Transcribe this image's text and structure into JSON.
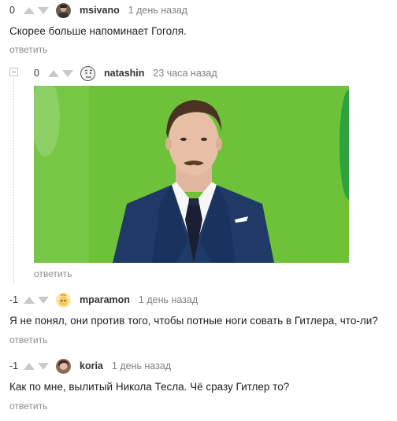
{
  "comments": [
    {
      "rating": "0",
      "username": "msivano",
      "time": "1 день назад",
      "text": "Скорее больше напоминает Гоголя.",
      "reply": "ответить"
    },
    {
      "rating": "0",
      "username": "natashin",
      "time": "23 часа назад",
      "reply": "ответить",
      "image": "photo-man-in-suit-green-background"
    },
    {
      "rating": "-1",
      "username": "mparamon",
      "time": "1 день назад",
      "text": "Я не понял, они против того, чтобы потные ноги совать в Гитлера, что-ли?",
      "reply": "ответить"
    },
    {
      "rating": "-1",
      "username": "koria",
      "time": "1 день назад",
      "text": "Как по мне, вылитый Никола Тесла. Чё сразу Гитлер то?",
      "reply": "ответить"
    }
  ],
  "colors": {
    "photo_background": "#6ec23a",
    "vote_arrow": "#c9c9c9",
    "muted_text": "#8c8c8c"
  }
}
